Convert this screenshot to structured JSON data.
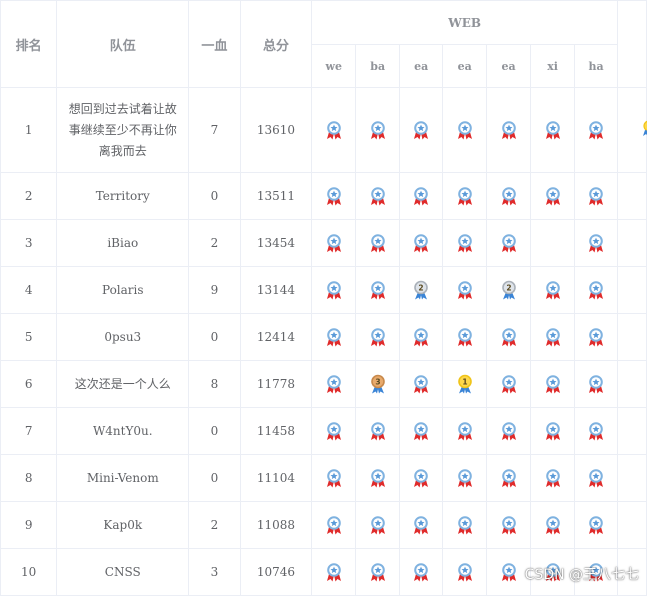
{
  "headers": {
    "rank": "排名",
    "team": "队伍",
    "first_blood": "一血",
    "total": "总分",
    "category": "WEB",
    "challenges": [
      "we",
      "ba",
      "ea",
      "ea",
      "ea",
      "xi",
      "ha"
    ]
  },
  "rows": [
    {
      "rank": "1",
      "team": "想回到过去试着让故事继续至少不再让你离我而去",
      "first_blood": "7",
      "total": "13610",
      "medals": [
        "solved",
        "solved",
        "solved",
        "solved",
        "solved",
        "solved",
        "solved"
      ]
    },
    {
      "rank": "2",
      "team": "Territory",
      "first_blood": "0",
      "total": "13511",
      "medals": [
        "solved",
        "solved",
        "solved",
        "solved",
        "solved",
        "solved",
        "solved"
      ]
    },
    {
      "rank": "3",
      "team": "iBiao",
      "first_blood": "2",
      "total": "13454",
      "medals": [
        "solved",
        "solved",
        "solved",
        "solved",
        "solved",
        "none",
        "solved"
      ]
    },
    {
      "rank": "4",
      "team": "Polaris",
      "first_blood": "9",
      "total": "13144",
      "medals": [
        "solved",
        "solved",
        "second",
        "solved",
        "second",
        "solved",
        "solved"
      ]
    },
    {
      "rank": "5",
      "team": "0psu3",
      "first_blood": "0",
      "total": "12414",
      "medals": [
        "solved",
        "solved",
        "solved",
        "solved",
        "solved",
        "solved",
        "solved"
      ]
    },
    {
      "rank": "6",
      "team": "这次还是一个人么",
      "first_blood": "8",
      "total": "11778",
      "medals": [
        "solved",
        "third",
        "solved",
        "first",
        "solved",
        "solved",
        "solved"
      ]
    },
    {
      "rank": "7",
      "team": "W4ntY0u.",
      "first_blood": "0",
      "total": "11458",
      "medals": [
        "solved",
        "solved",
        "solved",
        "solved",
        "solved",
        "solved",
        "solved"
      ]
    },
    {
      "rank": "8",
      "team": "Mini-Venom",
      "first_blood": "0",
      "total": "11104",
      "medals": [
        "solved",
        "solved",
        "solved",
        "solved",
        "solved",
        "solved",
        "solved"
      ]
    },
    {
      "rank": "9",
      "team": "Kap0k",
      "first_blood": "2",
      "total": "11088",
      "medals": [
        "solved",
        "solved",
        "solved",
        "solved",
        "solved",
        "solved",
        "solved"
      ]
    },
    {
      "rank": "10",
      "team": "CNSS",
      "first_blood": "3",
      "total": "10746",
      "medals": [
        "solved",
        "solved",
        "solved",
        "solved",
        "solved",
        "solved",
        "solved"
      ]
    }
  ],
  "medal_labels": {
    "first": "1",
    "second": "2",
    "third": "3"
  },
  "colors": {
    "solved_ribbon": "#e02b2b",
    "solved_ring": "#7fb2e0",
    "solved_fill": "#ffffff",
    "solved_star": "#5a9ad8",
    "first_ribbon": "#3a84d6",
    "first_ring": "#f0c419",
    "first_fill": "#ffd84a",
    "second_ribbon": "#3a84d6",
    "second_ring": "#a9b0b8",
    "second_fill": "#dfe4ea",
    "third_ribbon": "#3a84d6",
    "third_ring": "#c8894b",
    "third_fill": "#e8aa6c",
    "border": "#ebeef5",
    "header_text": "#909399",
    "cell_text": "#606266"
  },
  "watermark": "CSDN @王八七七"
}
